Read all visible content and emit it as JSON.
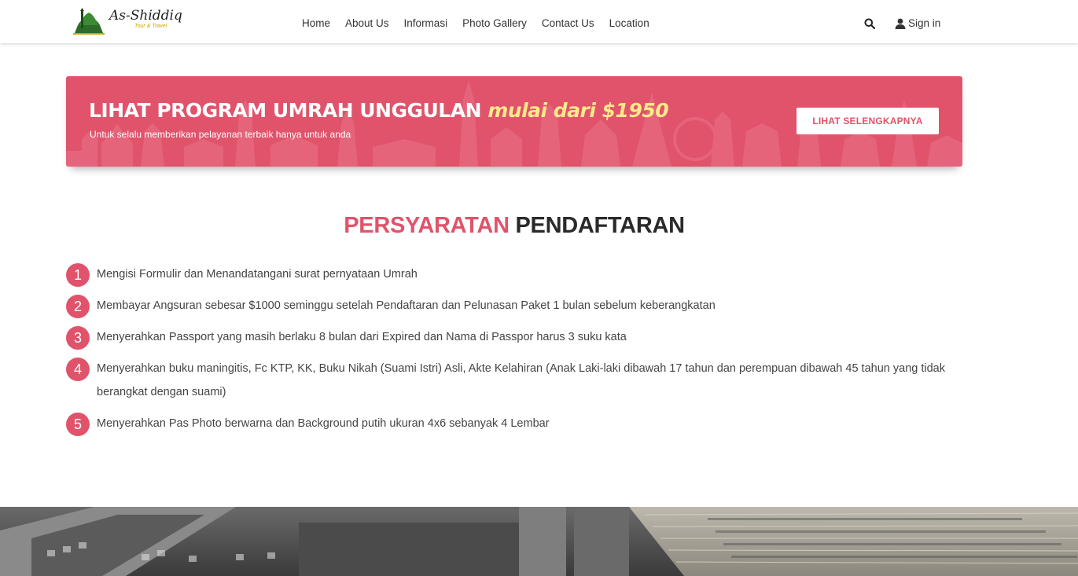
{
  "brand": {
    "name": "As-Shiddiq",
    "tagline": "Tour & Travel"
  },
  "nav": {
    "items": [
      "Home",
      "About Us",
      "Informasi",
      "Photo Gallery",
      "Contact Us",
      "Location"
    ],
    "signin_label": "Sign in"
  },
  "banner": {
    "title_main": "LIHAT PROGRAM UMRAH UNGGULAN",
    "title_highlight": "mulai dari $1950",
    "subtitle": "Untuk selalu memberikan pelayanan terbaik hanya untuk anda",
    "button_label": "LIHAT SELENGKAPNYA"
  },
  "section": {
    "title_part1": "PERSYARATAN",
    "title_part2": "PENDAFTARAN",
    "items": [
      {
        "num": "1",
        "text": "Mengisi Formulir dan Menandatangani surat pernyataan Umrah"
      },
      {
        "num": "2",
        "text": "Membayar Angsuran sebesar $1000 seminggu setelah Pendaftaran dan Pelunasan Paket 1 bulan sebelum keberangkatan"
      },
      {
        "num": "3",
        "text": "Menyerahkan Passport yang masih berlaku 8 bulan dari Expired dan Nama di Passpor harus 3 suku kata"
      },
      {
        "num": "4",
        "text": "Menyerahkan buku maningitis, Fc KTP, KK, Buku Nikah (Suami Istri) Asli, Akte Kelahiran (Anak Laki-laki dibawah 17 tahun dan perempuan dibawah 45 tahun yang tidak berangkat dengan suami)"
      },
      {
        "num": "5",
        "text": "Menyerahkan Pas Photo berwarna dan Background putih ukuran 4x6 sebanyak 4 Lembar"
      }
    ]
  },
  "colors": {
    "accent": "#e0536b",
    "highlight": "#ffe98a",
    "dark": "#2a2a2a"
  }
}
